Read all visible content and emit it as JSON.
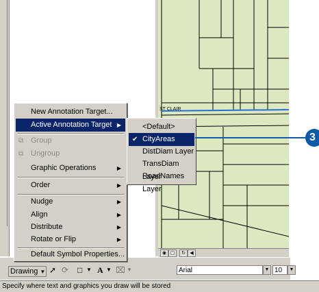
{
  "colors": {
    "map_fill": "#dbe8c0",
    "menu_bg": "#d4d0c8",
    "selection": "#0a246a",
    "callout": "#0d5aa7"
  },
  "map": {
    "street_label": "ST CLAIR"
  },
  "context_menu": {
    "items": [
      {
        "label": "New Annotation Target...",
        "state": "normal",
        "submenu": false
      },
      {
        "label": "Active Annotation Target",
        "state": "selected",
        "submenu": true
      },
      {
        "label": "Group",
        "state": "disabled",
        "submenu": false
      },
      {
        "label": "Ungroup",
        "state": "disabled",
        "submenu": false
      },
      {
        "label": "Graphic Operations",
        "state": "normal",
        "submenu": true
      },
      {
        "label": "Order",
        "state": "normal",
        "submenu": true
      },
      {
        "label": "Nudge",
        "state": "normal",
        "submenu": true
      },
      {
        "label": "Align",
        "state": "normal",
        "submenu": true
      },
      {
        "label": "Distribute",
        "state": "normal",
        "submenu": true
      },
      {
        "label": "Rotate or Flip",
        "state": "normal",
        "submenu": true
      },
      {
        "label": "Default Symbol Properties...",
        "state": "normal",
        "submenu": false
      }
    ]
  },
  "submenu": {
    "items": [
      {
        "label": "<Default>",
        "checked": false,
        "selected": false
      },
      {
        "label": "CityAreas",
        "checked": true,
        "selected": true
      },
      {
        "label": "DistDiam Layer",
        "checked": false,
        "selected": false
      },
      {
        "label": "TransDiam Layer",
        "checked": false,
        "selected": false
      },
      {
        "label": "RoadNames Layer",
        "checked": false,
        "selected": false
      }
    ]
  },
  "toolbar": {
    "drawing_label": "Drawing",
    "font_value": "Arial",
    "size_value": "10",
    "text_tool": "A"
  },
  "callout": {
    "number": "3"
  },
  "status_bar": {
    "text": "Specify where text and graphics you draw will be stored"
  }
}
